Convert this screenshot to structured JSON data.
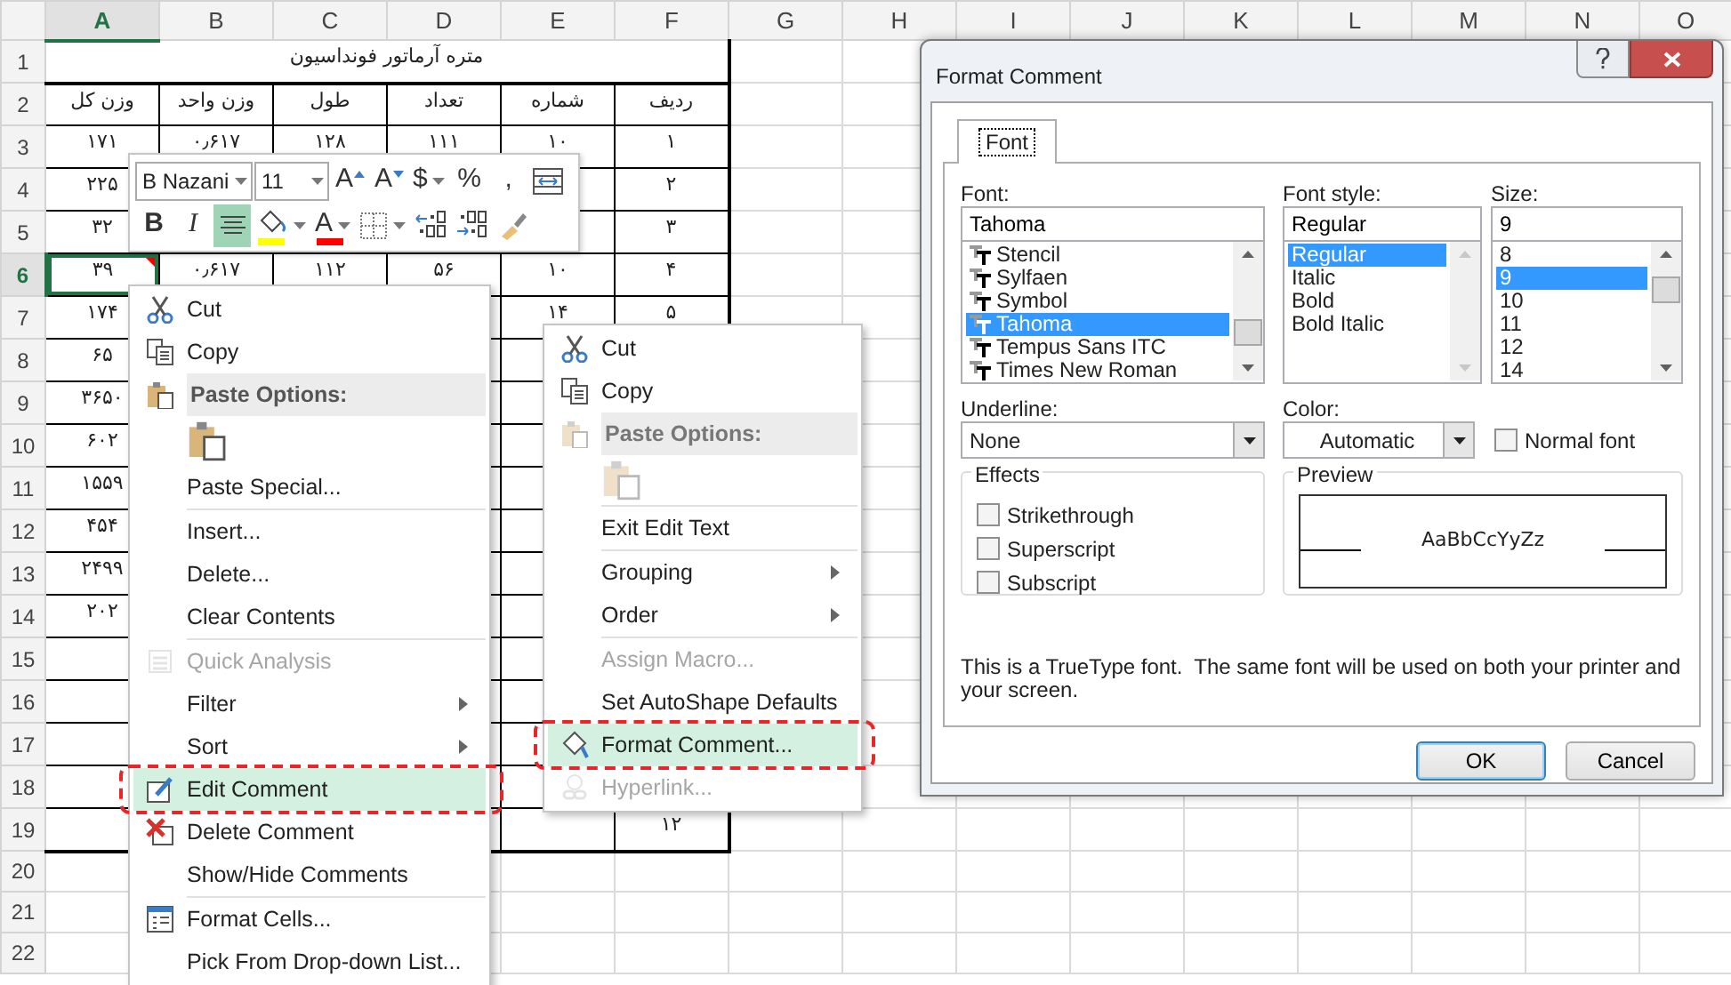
{
  "spreadsheet": {
    "columns": [
      {
        "label": "A",
        "selected": true
      },
      {
        "label": "B",
        "selected": false
      },
      {
        "label": "C",
        "selected": false
      },
      {
        "label": "D",
        "selected": false
      },
      {
        "label": "E",
        "selected": false
      },
      {
        "label": "F",
        "selected": false
      },
      {
        "label": "G",
        "selected": false
      },
      {
        "label": "H",
        "selected": false
      },
      {
        "label": "I",
        "selected": false
      },
      {
        "label": "J",
        "selected": false
      },
      {
        "label": "K",
        "selected": false
      },
      {
        "label": "L",
        "selected": false
      },
      {
        "label": "M",
        "selected": false
      },
      {
        "label": "N",
        "selected": false
      },
      {
        "label": "O",
        "selected": false
      }
    ],
    "rows": [
      {
        "label": "1",
        "selected": false,
        "kind": "title",
        "cells": [
          "متره آرماتور فونداسیون"
        ]
      },
      {
        "label": "2",
        "selected": false,
        "kind": "data",
        "cells": [
          "ردیف",
          "شماره",
          "تعداد",
          "طول",
          "وزن واحد",
          "وزن کل"
        ]
      },
      {
        "label": "3",
        "selected": false,
        "kind": "data",
        "cells": [
          "۱",
          "۱۰",
          "۱۱۱",
          "۱۲۸",
          "۰٫۶۱۷",
          "۱۷۱"
        ]
      },
      {
        "label": "4",
        "selected": false,
        "kind": "data",
        "cells": [
          "۲",
          null,
          null,
          null,
          null,
          "۲۲۵"
        ]
      },
      {
        "label": "5",
        "selected": false,
        "kind": "data",
        "cells": [
          "۳",
          null,
          null,
          null,
          null,
          "۳۲"
        ]
      },
      {
        "label": "6",
        "selected": true,
        "kind": "data",
        "cells": [
          "۴",
          "۱۰",
          "۵۶",
          "۱۱۲",
          "۰٫۶۱۷",
          "۳۹"
        ]
      },
      {
        "label": "7",
        "selected": false,
        "kind": "data",
        "cells": [
          "۵",
          "۱۴",
          null,
          null,
          null,
          "۱۷۴"
        ]
      },
      {
        "label": "8",
        "selected": false,
        "kind": "data",
        "cells": [
          null,
          null,
          null,
          null,
          null,
          "۶۵"
        ]
      },
      {
        "label": "9",
        "selected": false,
        "kind": "data",
        "cells": [
          null,
          null,
          null,
          null,
          null,
          "۳۶۵۰"
        ]
      },
      {
        "label": "10",
        "selected": false,
        "kind": "data",
        "cells": [
          null,
          null,
          null,
          null,
          null,
          "۶۰۲"
        ]
      },
      {
        "label": "11",
        "selected": false,
        "kind": "data",
        "cells": [
          null,
          null,
          null,
          null,
          null,
          "۱۵۵۹"
        ]
      },
      {
        "label": "12",
        "selected": false,
        "kind": "data",
        "cells": [
          null,
          null,
          null,
          null,
          null,
          "۴۵۴"
        ]
      },
      {
        "label": "13",
        "selected": false,
        "kind": "data",
        "cells": [
          null,
          null,
          null,
          null,
          null,
          "۲۴۹۹"
        ]
      },
      {
        "label": "14",
        "selected": false,
        "kind": "data",
        "cells": [
          null,
          null,
          null,
          null,
          null,
          "۲۰۲"
        ]
      },
      {
        "label": "15",
        "selected": false,
        "kind": "data",
        "cells": [
          null,
          null,
          null,
          null,
          null,
          null
        ]
      },
      {
        "label": "16",
        "selected": false,
        "kind": "data",
        "cells": [
          null,
          null,
          null,
          null,
          null,
          null
        ]
      },
      {
        "label": "17",
        "selected": false,
        "kind": "data",
        "cells": [
          null,
          null,
          null,
          null,
          null,
          null
        ]
      },
      {
        "label": "18",
        "selected": false,
        "kind": "data",
        "cells": [
          null,
          null,
          null,
          null,
          null,
          null
        ]
      },
      {
        "label": "19",
        "selected": false,
        "kind": "data",
        "cells": [
          "۱۲",
          null,
          null,
          null,
          null,
          null
        ]
      },
      {
        "label": "20",
        "selected": false,
        "kind": "blank"
      },
      {
        "label": "21",
        "selected": false,
        "kind": "blank"
      },
      {
        "label": "22",
        "selected": false,
        "kind": "blank"
      }
    ],
    "active_cell_has_comment": true
  },
  "mini_toolbar": {
    "font_row": [
      {
        "kind": "combo",
        "value": "B Nazani"
      },
      {
        "kind": "combo",
        "value": "11"
      },
      {
        "kind": "text",
        "label": "A"
      },
      {
        "kind": "text",
        "label": "A"
      },
      {
        "kind": "text",
        "label": "$",
        "dropdown": true
      },
      {
        "kind": "text",
        "label": "%"
      },
      {
        "kind": "text",
        "label": ","
      },
      {
        "kind": "icon"
      }
    ],
    "format_row": [
      {
        "kind": "text",
        "label": "B",
        "on": false
      },
      {
        "kind": "text",
        "label": "I",
        "on": false
      },
      {
        "kind": "icon",
        "on": true
      },
      {
        "kind": "icon",
        "color": "#ffff00",
        "dropdown": true
      },
      {
        "kind": "text",
        "label": "A",
        "color": "#ff0000",
        "dropdown": true
      },
      {
        "kind": "icon",
        "dropdown": true
      },
      {
        "kind": "icon"
      },
      {
        "kind": "icon"
      },
      {
        "kind": "icon"
      }
    ]
  },
  "cell_menu": {
    "items": [
      {
        "kind": "item",
        "label": "Cut",
        "disabled": false,
        "selected": false
      },
      {
        "kind": "item",
        "label": "Copy",
        "disabled": false,
        "selected": false
      },
      {
        "kind": "header",
        "label": "Paste Options:",
        "disabled": false
      },
      {
        "kind": "paste",
        "disabled": false
      },
      {
        "kind": "item",
        "label": "Paste Special...",
        "disabled": false,
        "selected": false
      },
      {
        "kind": "separator"
      },
      {
        "kind": "item",
        "label": "Insert...",
        "disabled": false,
        "selected": false
      },
      {
        "kind": "item",
        "label": "Delete...",
        "disabled": false,
        "selected": false
      },
      {
        "kind": "item",
        "label": "Clear Contents",
        "disabled": false,
        "selected": false
      },
      {
        "kind": "separator"
      },
      {
        "kind": "item",
        "label": "Quick Analysis",
        "disabled": true,
        "selected": false
      },
      {
        "kind": "item",
        "label": "Filter",
        "disabled": false,
        "selected": false,
        "submenu": true
      },
      {
        "kind": "item",
        "label": "Sort",
        "disabled": false,
        "selected": false,
        "submenu": true
      },
      {
        "kind": "item",
        "label": "Edit Comment",
        "disabled": false,
        "selected": true,
        "annotated": true
      },
      {
        "kind": "item",
        "label": "Delete Comment",
        "disabled": false,
        "selected": false
      },
      {
        "kind": "item",
        "label": "Show/Hide Comments",
        "disabled": false,
        "selected": false
      },
      {
        "kind": "separator"
      },
      {
        "kind": "item",
        "label": "Format Cells...",
        "disabled": false,
        "selected": false
      },
      {
        "kind": "item",
        "label": "Pick From Drop-down List...",
        "disabled": false,
        "selected": false
      }
    ]
  },
  "comment_menu": {
    "items": [
      {
        "kind": "item",
        "label": "Cut",
        "disabled": false,
        "selected": false
      },
      {
        "kind": "item",
        "label": "Copy",
        "disabled": false,
        "selected": false
      },
      {
        "kind": "header",
        "label": "Paste Options:",
        "disabled": true
      },
      {
        "kind": "paste",
        "disabled": true
      },
      {
        "kind": "separator"
      },
      {
        "kind": "item",
        "label": "Exit Edit Text",
        "disabled": false,
        "selected": false
      },
      {
        "kind": "separator"
      },
      {
        "kind": "item",
        "label": "Grouping",
        "disabled": false,
        "selected": false,
        "submenu": true
      },
      {
        "kind": "item",
        "label": "Order",
        "disabled": false,
        "selected": false,
        "submenu": true
      },
      {
        "kind": "separator"
      },
      {
        "kind": "item",
        "label": "Assign Macro...",
        "disabled": true,
        "selected": false
      },
      {
        "kind": "item",
        "label": "Set AutoShape Defaults",
        "disabled": false,
        "selected": false
      },
      {
        "kind": "item",
        "label": "Format Comment...",
        "disabled": false,
        "selected": true,
        "annotated": true
      },
      {
        "kind": "item",
        "label": "Hyperlink...",
        "disabled": true,
        "selected": false
      }
    ]
  },
  "dialog": {
    "title": "Format Comment",
    "tabs": [
      {
        "label": "Font",
        "selected": true
      }
    ],
    "font": {
      "label": "Font:",
      "value": "Tahoma",
      "items": [
        {
          "label": "Stencil",
          "selected": false
        },
        {
          "label": "Sylfaen",
          "selected": false
        },
        {
          "label": "Symbol",
          "selected": false
        },
        {
          "label": "Tahoma",
          "selected": true
        },
        {
          "label": "Tempus Sans ITC",
          "selected": false
        },
        {
          "label": "Times New Roman",
          "selected": false
        }
      ]
    },
    "font_style": {
      "label": "Font style:",
      "value": "Regular",
      "items": [
        {
          "label": "Regular",
          "selected": true
        },
        {
          "label": "Italic",
          "selected": false
        },
        {
          "label": "Bold",
          "selected": false
        },
        {
          "label": "Bold Italic",
          "selected": false
        }
      ]
    },
    "size": {
      "label": "Size:",
      "value": "9",
      "items": [
        {
          "label": "8",
          "selected": false
        },
        {
          "label": "9",
          "selected": true
        },
        {
          "label": "10",
          "selected": false
        },
        {
          "label": "11",
          "selected": false
        },
        {
          "label": "12",
          "selected": false
        },
        {
          "label": "14",
          "selected": false
        }
      ]
    },
    "underline": {
      "label": "Underline:",
      "value": "None"
    },
    "color": {
      "label": "Color:",
      "value": "Automatic"
    },
    "normal_font": {
      "label": "Normal font",
      "checked": false
    },
    "effects": {
      "title": "Effects",
      "options": [
        {
          "label": "Strikethrough",
          "checked": false
        },
        {
          "label": "Superscript",
          "checked": false
        },
        {
          "label": "Subscript",
          "checked": false
        }
      ]
    },
    "preview": {
      "title": "Preview",
      "sample": "AaBbCcYyZz"
    },
    "note": "This is a TrueType font.  The same font will be used on both your printer and your screen.",
    "buttons": [
      {
        "label": "OK",
        "default": true
      },
      {
        "label": "Cancel",
        "default": false
      }
    ]
  }
}
